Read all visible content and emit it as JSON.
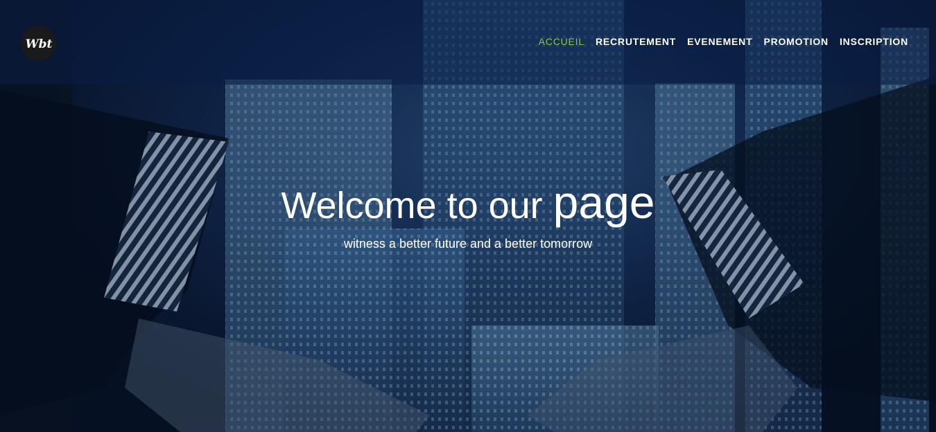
{
  "logo": {
    "text": "Wbt",
    "icon": "wbt-logo-icon"
  },
  "nav": {
    "items": [
      {
        "label": "ACCUEIL",
        "active": true
      },
      {
        "label": "RECRUTEMENT",
        "active": false
      },
      {
        "label": "EVENEMENT",
        "active": false
      },
      {
        "label": "PROMOTION",
        "active": false
      },
      {
        "label": "INSCRIPTION",
        "active": false
      }
    ],
    "active_color": "#8dc63f"
  },
  "hero": {
    "title_part1": "Welcome to our ",
    "title_part2": "page",
    "subtitle": "witness a better future and a better tomorrow"
  }
}
